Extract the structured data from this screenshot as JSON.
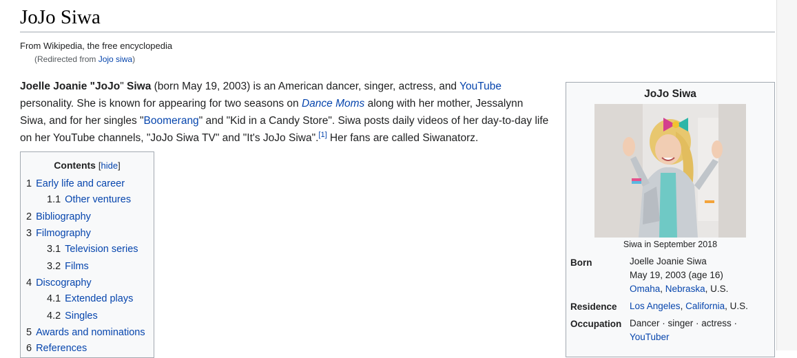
{
  "page": {
    "title": "JoJo Siwa",
    "tagline": "From Wikipedia, the free encyclopedia",
    "redirect_prefix": "(Redirected from ",
    "redirect_link": "Jojo siwa",
    "redirect_suffix": ")"
  },
  "lead": {
    "p1": "Joelle Joanie \"",
    "p2": "JoJo",
    "p3": "\" ",
    "p4": "Siwa",
    "p5": " (born May 19, 2003) is an American dancer, singer, actress, and ",
    "link_youtube": "YouTube",
    "p6": " personality. She is known for appearing for two seasons on ",
    "link_dance_moms": "Dance Moms",
    "p7": " along with her mother, Jessalynn Siwa, and for her singles \"",
    "link_boomerang": "Boomerang",
    "p8": "\" and \"Kid in a Candy Store\". Siwa posts daily videos of her day-to-day life on her YouTube channels, \"JoJo Siwa TV\" and \"It's JoJo Siwa\".",
    "ref": "[1]",
    "p9": " Her fans are called Siwanatorz."
  },
  "toc": {
    "title": "Contents",
    "hide_open": "[",
    "hide": "hide",
    "hide_close": "]",
    "items": [
      {
        "num": "1",
        "label": "Early life and career"
      },
      {
        "num": "1.1",
        "label": "Other ventures"
      },
      {
        "num": "2",
        "label": "Bibliography"
      },
      {
        "num": "3",
        "label": "Filmography"
      },
      {
        "num": "3.1",
        "label": "Television series"
      },
      {
        "num": "3.2",
        "label": "Films"
      },
      {
        "num": "4",
        "label": "Discography"
      },
      {
        "num": "4.1",
        "label": "Extended plays"
      },
      {
        "num": "4.2",
        "label": "Singles"
      },
      {
        "num": "5",
        "label": "Awards and nominations"
      },
      {
        "num": "6",
        "label": "References"
      }
    ]
  },
  "infobox": {
    "title": "JoJo Siwa",
    "caption": "Siwa in September 2018",
    "born_label": "Born",
    "born_name": "Joelle Joanie Siwa",
    "born_date": "May 19, 2003 (age 16)",
    "born_city": "Omaha",
    "born_state": "Nebraska",
    "born_country": ", U.S.",
    "residence_label": "Residence",
    "residence_city": "Los Angeles",
    "residence_state": "California",
    "residence_country": ", U.S.",
    "occupation_label": "Occupation",
    "occupation_text": "Dancer · singer · actress ·",
    "occupation_link": "YouTuber"
  },
  "colors": {
    "link": "#0645ad",
    "text": "#202122",
    "infobox_bg": "#f8f9fa",
    "border": "#a2a9b1"
  }
}
